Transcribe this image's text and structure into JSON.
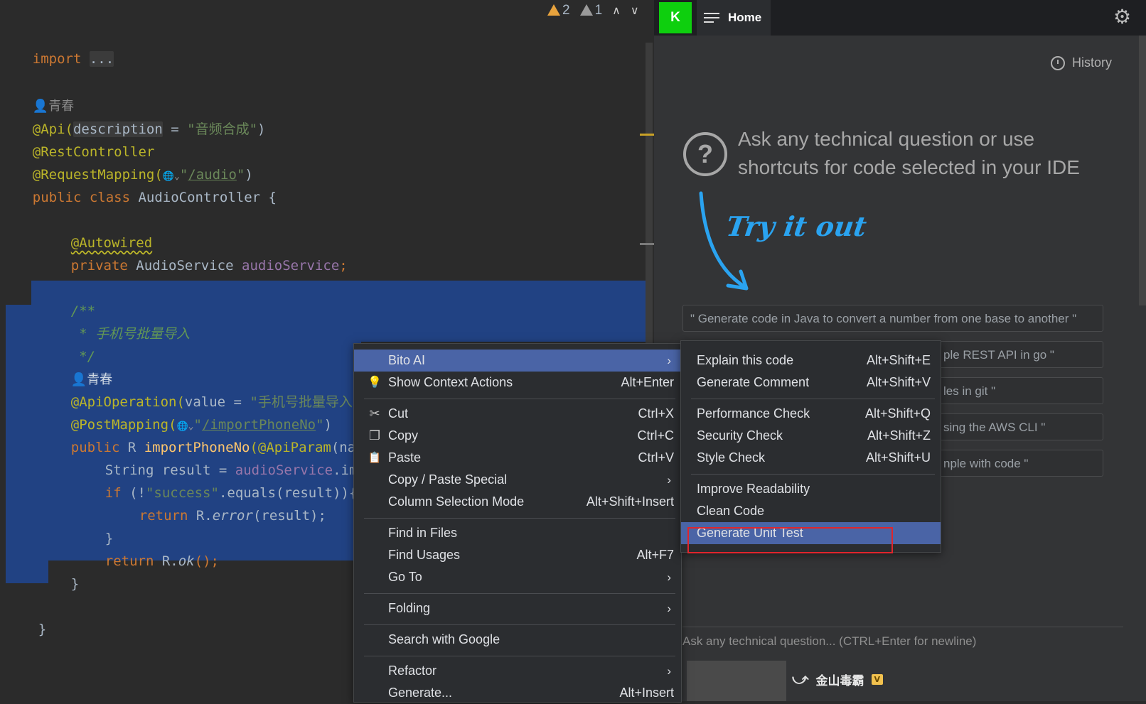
{
  "editor": {
    "lines": {
      "import_kw": "import",
      "import_dots": "...",
      "author1": "青春",
      "api_ann": "@Api(",
      "api_param": "description",
      "api_eq": " = ",
      "api_str": "\"音频合成\"",
      "api_close": ")",
      "rest_controller": "@RestController",
      "req_mapping": "@RequestMapping(",
      "req_mapping_globe": "🌐⌄",
      "req_mapping_q1": "\"",
      "req_mapping_path": "/audio",
      "req_mapping_q2": "\"",
      "req_mapping_close": ")",
      "public_class_kw": "public class ",
      "class_name": "AudioController {",
      "autowired": "@Autowired",
      "private_kw": "private ",
      "service_type": "AudioService ",
      "service_field": "audioService",
      "semicolon": ";",
      "doc_open": "/**",
      "doc_text": " * 手机号批量导入",
      "doc_close": " */",
      "author2": "青春",
      "apiop_ann": "@ApiOperation(",
      "apiop_value": "value = ",
      "apiop_str": "\"手机号批量导入\",",
      "post_ann": "@PostMapping(",
      "post_globe": "🌐⌄",
      "post_q1": "\"",
      "post_path": "/importPhoneNo",
      "post_q2": "\"",
      "post_close": ")",
      "method_public": "public ",
      "method_type": "R ",
      "method_name": "importPhoneNo",
      "method_param_ann": "(@ApiParam",
      "method_param_rest": "(name",
      "string_result": "String result = ",
      "service_call": "audioService",
      "service_call_rest": ".impo",
      "if_kw": "if ",
      "if_open": "(!",
      "success_str": "\"success\"",
      "if_rest": ".equals(result)){",
      "return_kw": "return ",
      "r_error_pre": "R.",
      "r_error": "error",
      "r_error_post": "(result);",
      "close_brace_inner": "}",
      "return_kw2": "return ",
      "r_ok_pre": "R.",
      "r_ok": "ok",
      "r_ok_post": "();",
      "close_brace_method": "}",
      "close_brace_class": "}"
    }
  },
  "toolbar": {
    "warnings_count": "2",
    "weak_warnings_count": "1",
    "up_arrow": "∧",
    "down_arrow": "∨"
  },
  "plugin": {
    "avatar_letter": "K",
    "home_tab": "Home",
    "history": "History",
    "help_glyph": "?",
    "ask_title": "Ask any technical question or use shortcuts for code selected in your IDE",
    "try_it_out": "Try it out",
    "suggestions": [
      "\" Generate code in Java to convert a number from one base to another \"",
      "ple REST API in go \"",
      "les in git \"",
      "sing the AWS CLI \"",
      "nple with code \""
    ],
    "input_placeholder": "Ask any technical question... (CTRL+Enter for newline)"
  },
  "tray": {
    "app_name": "金山毒霸",
    "badge": "V",
    "logo": "⤻"
  },
  "context_menu": {
    "items": [
      {
        "label": "Bito AI",
        "shortcut": "",
        "submenu": true
      },
      {
        "label": "Show Context Actions",
        "shortcut": "Alt+Enter"
      },
      {
        "label": "Cut",
        "shortcut": "Ctrl+X",
        "icon": "✂"
      },
      {
        "label": "Copy",
        "shortcut": "Ctrl+C",
        "icon": "❐"
      },
      {
        "label": "Paste",
        "shortcut": "Ctrl+V",
        "icon": "📋"
      },
      {
        "label": "Copy / Paste Special",
        "shortcut": "",
        "submenu": true
      },
      {
        "label": "Column Selection Mode",
        "shortcut": "Alt+Shift+Insert"
      },
      {
        "label": "Find in Files",
        "shortcut": ""
      },
      {
        "label": "Find Usages",
        "shortcut": "Alt+F7"
      },
      {
        "label": "Go To",
        "shortcut": "",
        "submenu": true
      },
      {
        "label": "Folding",
        "shortcut": "",
        "submenu": true
      },
      {
        "label": "Search with Google",
        "shortcut": ""
      },
      {
        "label": "Refactor",
        "shortcut": "",
        "submenu": true
      },
      {
        "label": "Generate...",
        "shortcut": "Alt+Insert"
      }
    ],
    "submenu_arrow": "›",
    "bulb_icon": "💡"
  },
  "bito_submenu": {
    "items": [
      {
        "label": "Explain this code",
        "shortcut": "Alt+Shift+E"
      },
      {
        "label": "Generate Comment",
        "shortcut": "Alt+Shift+V"
      },
      {
        "label": "Performance Check",
        "shortcut": "Alt+Shift+Q"
      },
      {
        "label": "Security Check",
        "shortcut": "Alt+Shift+Z"
      },
      {
        "label": "Style Check",
        "shortcut": "Alt+Shift+U"
      },
      {
        "label": "Improve Readability",
        "shortcut": ""
      },
      {
        "label": "Clean Code",
        "shortcut": ""
      },
      {
        "label": "Generate Unit Test",
        "shortcut": ""
      }
    ]
  },
  "colors": {
    "selection": "#214283",
    "menu_active": "#4a64a6",
    "highlight_box": "#e0252c",
    "avatar_green": "#0ecf0e",
    "try_it_blue": "#2aa3f0"
  }
}
